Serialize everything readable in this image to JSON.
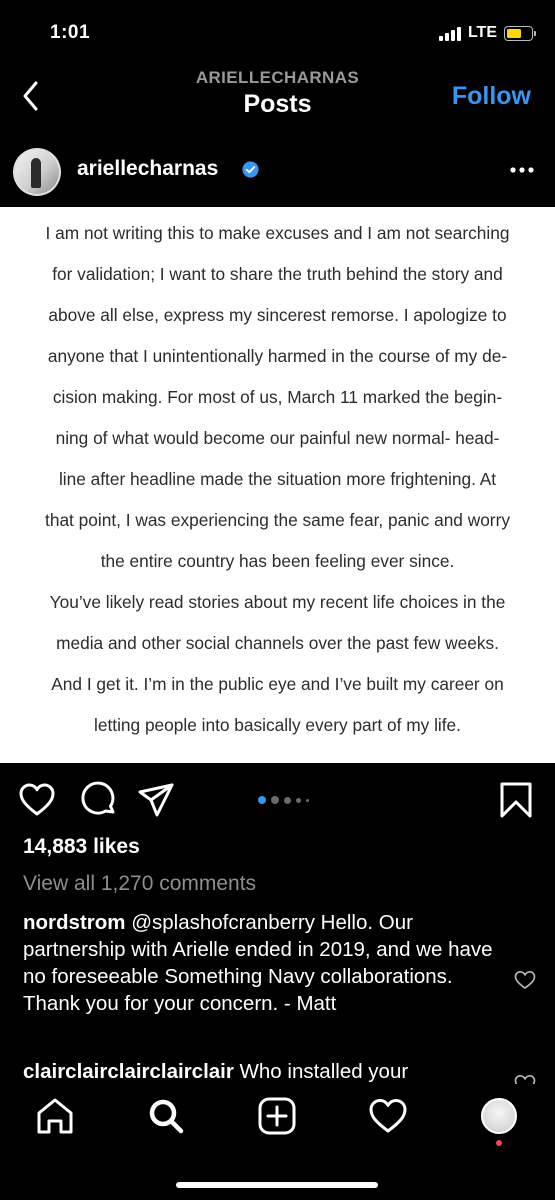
{
  "status_bar": {
    "time": "1:01",
    "network": "LTE",
    "battery_color": "#ffd60a"
  },
  "header": {
    "username_caps": "ARIELLECHARNAS",
    "title": "Posts",
    "follow_label": "Follow",
    "follow_color": "#3797f0"
  },
  "post": {
    "username": "ariellecharnas",
    "verified": true,
    "image_text_lines": [
      "I am not writing this to make excuses and I am not searching",
      "for validation; I want to share the truth behind the story and",
      "above all else, express my sincerest remorse. I apologize to",
      "anyone that I unintentionally harmed in the course of my de-",
      "cision making. For most of us, March 11 marked the begin-",
      "ning of what would become our painful new normal- head-",
      "line after headline made the situation more frightening. At",
      "that point, I was experiencing the same fear, panic and worry",
      "the entire country has been feeling ever since.",
      "You’ve likely read stories about my recent life choices in the",
      "media and other social channels over the past few weeks.",
      "And I get it. I’m in the public eye and I’ve built my career on",
      "letting people into basically every part of my life."
    ],
    "carousel": {
      "total_dots": 5,
      "active_index": 0
    },
    "likes": "14,883 likes",
    "view_comments": "View all 1,270 comments",
    "comments": [
      {
        "user": "nordstrom",
        "text": " @splashofcranberry Hello. Our partnership with Arielle ended in 2019, and we have no foreseeable Something Navy collaborations. Thank you for your concern. - Matt"
      },
      {
        "user": "clairclairclairclairclair",
        "text": " Who installed your"
      }
    ]
  },
  "icons": {
    "back": "chevron-left-icon",
    "verified": "verified-badge-icon",
    "more": "more-horizontal-icon",
    "like": "heart-icon",
    "comment": "comment-bubble-icon",
    "share": "paper-plane-icon",
    "save": "bookmark-icon",
    "tabs": [
      "home-icon",
      "search-icon",
      "create-post-icon",
      "activity-heart-icon",
      "profile-avatar"
    ]
  }
}
